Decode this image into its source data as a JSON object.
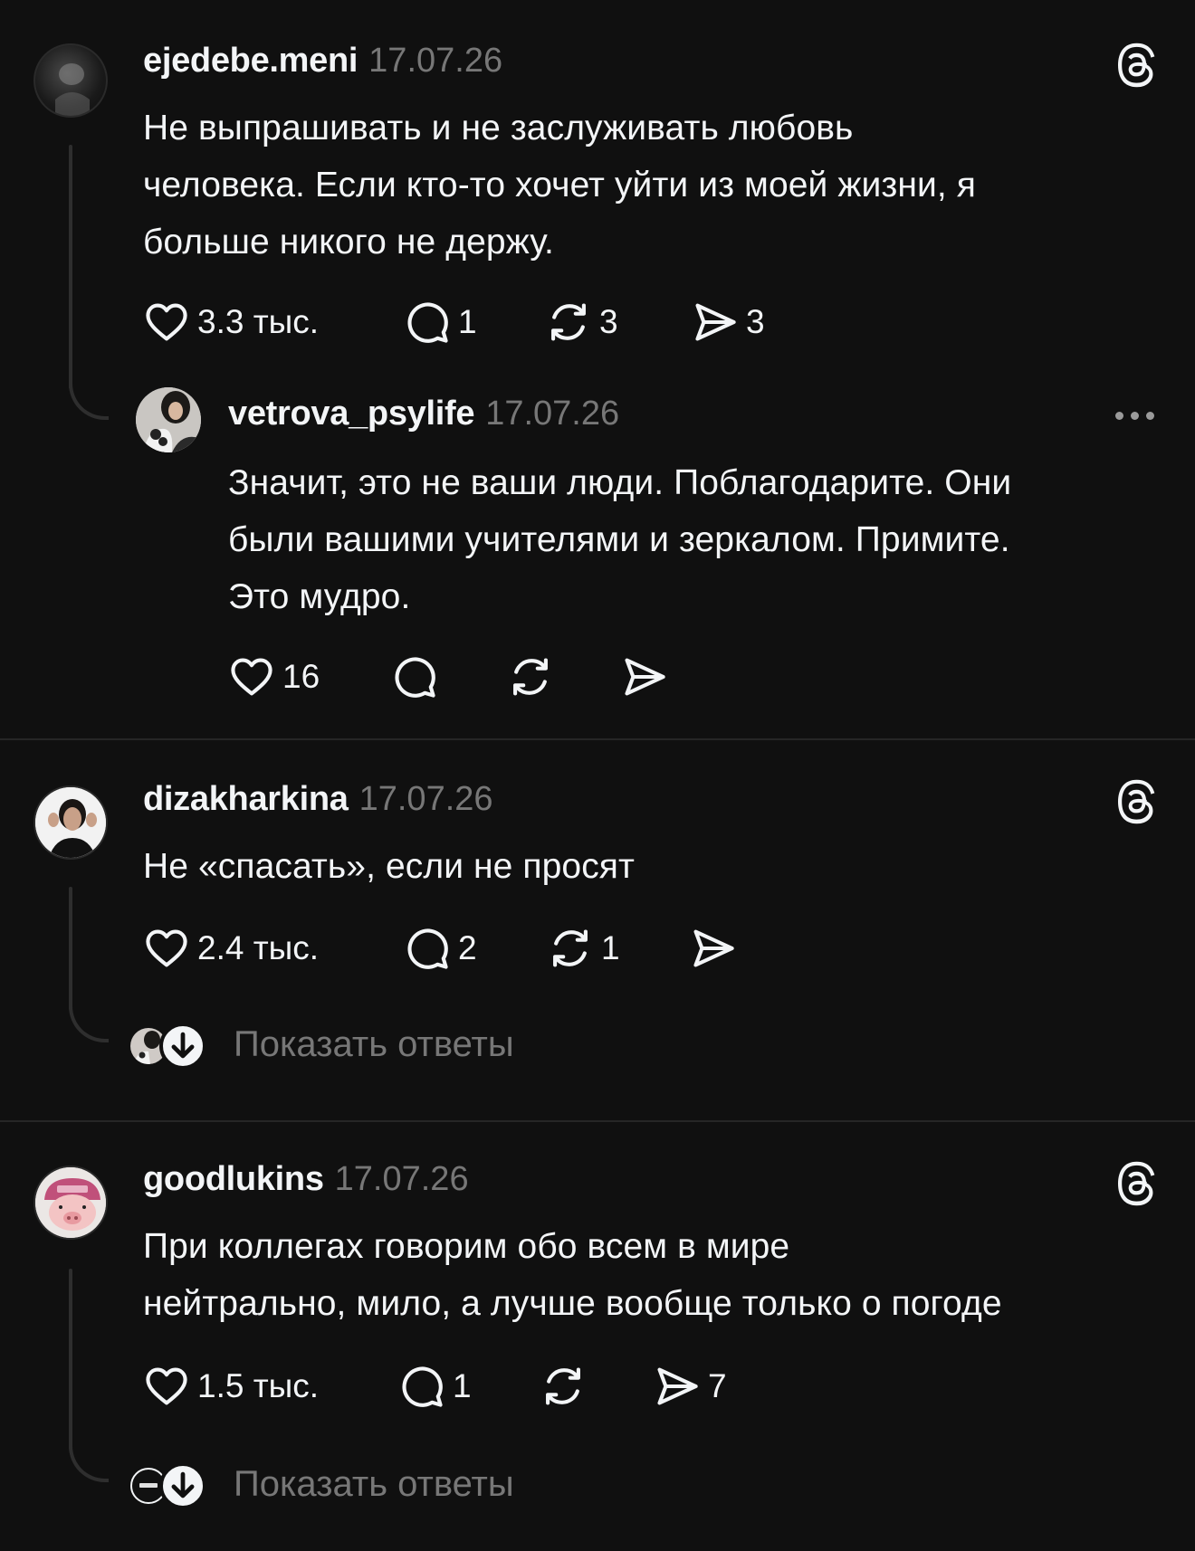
{
  "posts": [
    {
      "username": "ejedebe.meni",
      "date": "17.07.26",
      "text": "Не выпрашивать и не заслуживать любовь\nчеловека. Если кто-то хочет уйти из моей жизни, я\nбольше никого не держу.",
      "likes": "3.3 тыс.",
      "replies": "1",
      "reposts": "3",
      "shares": "3",
      "avatar_icon": "avatar-dark-photo"
    },
    {
      "username": "vetrova_psylife",
      "date": "17.07.26",
      "text": "Значит, это не ваши люди. Поблагодарите. Они\nбыли вашими учителями и зеркалом. Примите.\nЭто мудро.",
      "likes": "16",
      "avatar_icon": "avatar-woman-with-dog"
    },
    {
      "username": "dizakharkina",
      "date": "17.07.26",
      "text": "Не «спасать», если не просят",
      "likes": "2.4 тыс.",
      "replies": "2",
      "reposts": "1",
      "show_replies": "Показать ответы",
      "avatar_icon": "avatar-woman-hands-ears"
    },
    {
      "username": "goodlukins",
      "date": "17.07.26",
      "text": "При коллегах говорим обо всем в мире\nнейтрально, мило, а лучше вообще только о погоде",
      "likes": "1.5 тыс.",
      "replies": "1",
      "shares": "7",
      "show_replies": "Показать ответы",
      "avatar_icon": "avatar-pig-pink-cap"
    }
  ],
  "icons": {
    "brand": "threads-logo-icon",
    "like": "heart-icon",
    "reply": "speech-bubble-icon",
    "repost": "repost-arrows-icon",
    "share": "send-icon",
    "more": "more-dots-icon",
    "expand": "arrow-down-icon"
  },
  "colors": {
    "background": "#101010",
    "text": "#f3f5f7",
    "muted": "#777777",
    "line": "#2e2e2e"
  }
}
